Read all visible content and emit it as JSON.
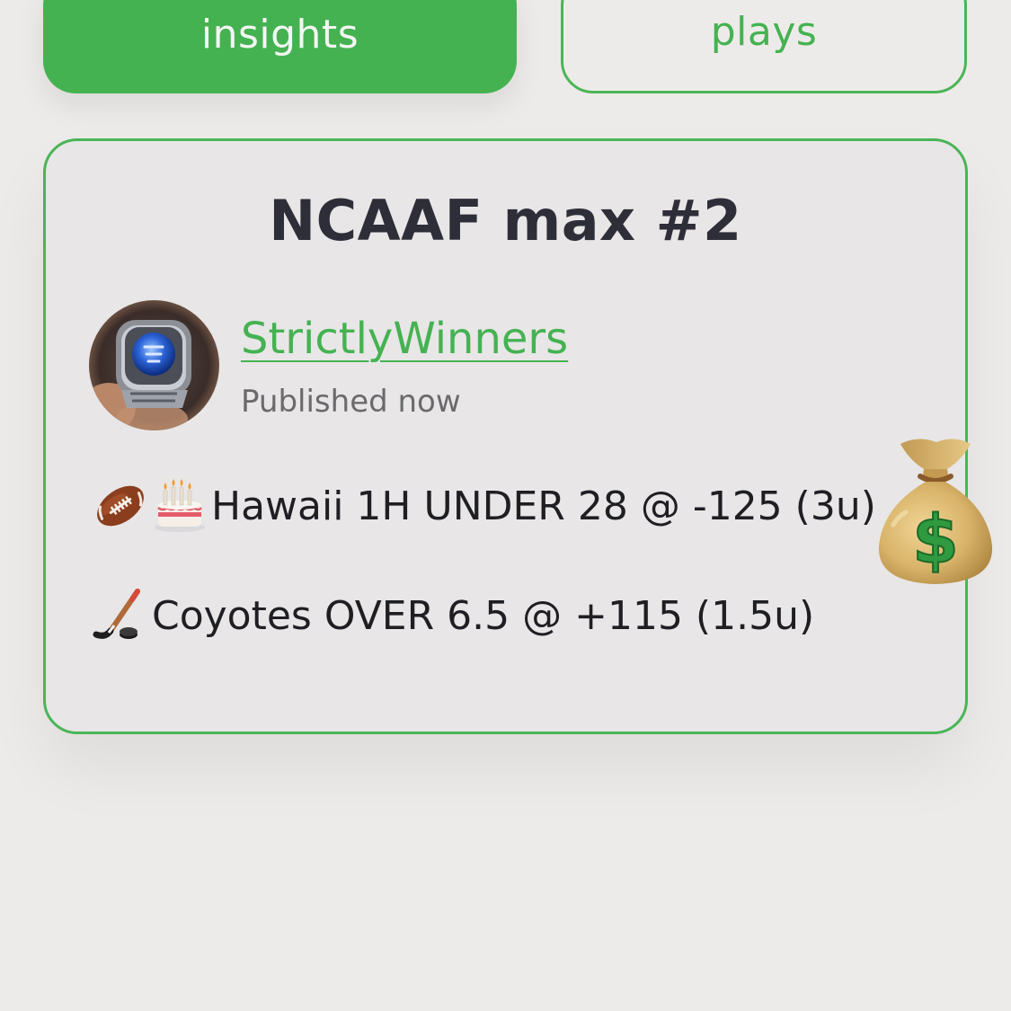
{
  "tabs": {
    "insights_label": "insights",
    "plays_label": "plays"
  },
  "card": {
    "title": "NCAAF max #2",
    "author": {
      "name": "StrictlyWinners",
      "status": "Published now"
    },
    "plays": [
      {
        "icons": [
          "american-football-icon",
          "birthday-cake-icon"
        ],
        "text": "Hawaii 1H UNDER 28 @ -125 (3u)"
      },
      {
        "icons": [
          "ice-hockey-icon"
        ],
        "text": "Coyotes OVER 6.5 @ +115 (1.5u)"
      }
    ]
  },
  "sticker": "money-bag-icon",
  "colors": {
    "accent": "#45b252",
    "background": "#edebe9",
    "card_background": "#e8e6e7",
    "title_text": "#2e2e39"
  }
}
